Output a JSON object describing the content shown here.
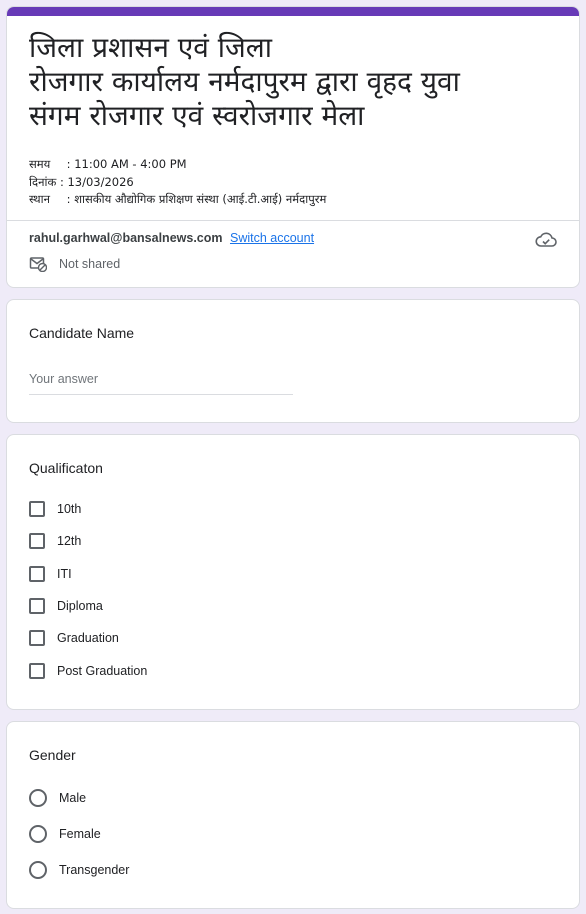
{
  "header": {
    "title_lines": [
      "जिला प्रशासन एवं जिला",
      "रोजगार कार्यालय नर्मदापुरम द्वारा वृहद युवा",
      "संगम रोजगार एवं स्वरोजगार मेला"
    ],
    "info": [
      {
        "label": "समय",
        "sep": ":",
        "value": "11:00 AM - 4:00 PM"
      },
      {
        "label": "दिनांक",
        "sep": ":",
        "value": "13/03/2026"
      },
      {
        "label": "स्थान",
        "sep": ":",
        "value": "शासकीय औद्योगिक प्रशिक्षण संस्था (आई.टी.आई) नर्मदापुरम"
      }
    ],
    "account_email": "rahul.garhwal@bansalnews.com",
    "switch_account": "Switch account",
    "not_shared": "Not shared",
    "accent_color": "#673ab7"
  },
  "candidate_name": {
    "title": "Candidate Name",
    "placeholder": "Your answer"
  },
  "qualification": {
    "title": "Qualificaton",
    "options": [
      "10th",
      "12th",
      "ITI",
      "Diploma",
      "Graduation",
      "Post Graduation"
    ]
  },
  "gender": {
    "title": "Gender",
    "options": [
      "Male",
      "Female",
      "Transgender"
    ]
  }
}
